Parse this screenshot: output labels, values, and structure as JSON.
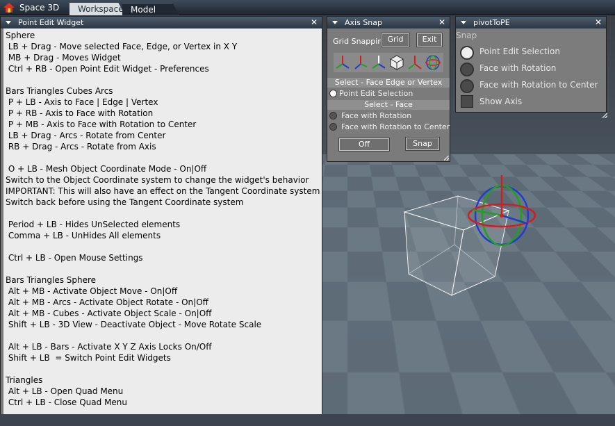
{
  "app": {
    "title": "Space 3D"
  },
  "tabs": [
    {
      "label": "Workspace",
      "active": true
    },
    {
      "label": "Model",
      "active": false
    }
  ],
  "point_edit_widget": {
    "title": "Point Edit Widget",
    "lines": [
      "Sphere",
      " LB + Drag - Move selected Face, Edge, or Vertex in X Y",
      " MB + Drag - Moves Widget",
      " Ctrl + RB - Open Point Edit Widget - Preferences",
      "",
      "Bars Triangles Cubes Arcs",
      " P + LB - Axis to Face | Edge | Vertex",
      " P + RB - Axis to Face with Rotation",
      " P + MB - Axis to Face with Rotation to Center",
      " LB + Drag - Arcs - Rotate from Center",
      " RB + Drag - Arcs - Rotate from Axis",
      "",
      " O + LB - Mesh Object Coordinate Mode - On|Off",
      "Switch to the Object Coordinate system to change the widget's behavior",
      "IMPORTANT: This will also have an effect on the Tangent Coordinate system",
      "Switch back before using the Tangent Coordinate system",
      "",
      " Period + LB - Hides UnSelected elements",
      " Comma + LB - UnHides All elements",
      "",
      " Ctrl + LB - Open Mouse Settings",
      "",
      "Bars Triangles Sphere",
      " Alt + MB - Activate Object Move - On|Off",
      " Alt + MB - Arcs - Activate Object Rotate - On|Off",
      " Alt + MB - Cubes - Activate Object Scale - On|Off",
      " Shift + LB - 3D View - Deactivate Object - Move Rotate Scale",
      "",
      " Alt + LB - Bars - Activate X Y Z Axis Locks On/Off",
      " Shift + LB  = Switch Point Edit Widgets",
      "",
      "Triangles",
      " Alt + LB - Open Quad Menu",
      " Ctrl + LB - Close Quad Menu"
    ]
  },
  "axis_snap": {
    "title": "Axis Snap",
    "grid_snapping_label": "Grid Snapping",
    "grid_button": "Grid",
    "exit_button": "Exit",
    "section1": "Select - Face Edge or Vertex",
    "option_point_edit": "Point Edit Selection",
    "section2": "Select - Face",
    "option_face_rotation": "Face with Rotation",
    "option_face_rotation_center": "Face with Rotation to Center",
    "off_button": "Off",
    "snap_button": "Snap"
  },
  "pivot_to_pe": {
    "title": "pivotToPE",
    "snap_label": "Snap",
    "options": [
      {
        "label": "Point Edit Selection",
        "selected": true
      },
      {
        "label": "Face with Rotation",
        "selected": false
      },
      {
        "label": "Face with Rotation to Center",
        "selected": false
      }
    ],
    "show_axis_label": "Show Axis"
  },
  "close_glyph": "✕",
  "colors": {
    "accent_red": "#d21e1e",
    "axis_green": "#1fa01f",
    "axis_blue": "#1e3cd2"
  }
}
